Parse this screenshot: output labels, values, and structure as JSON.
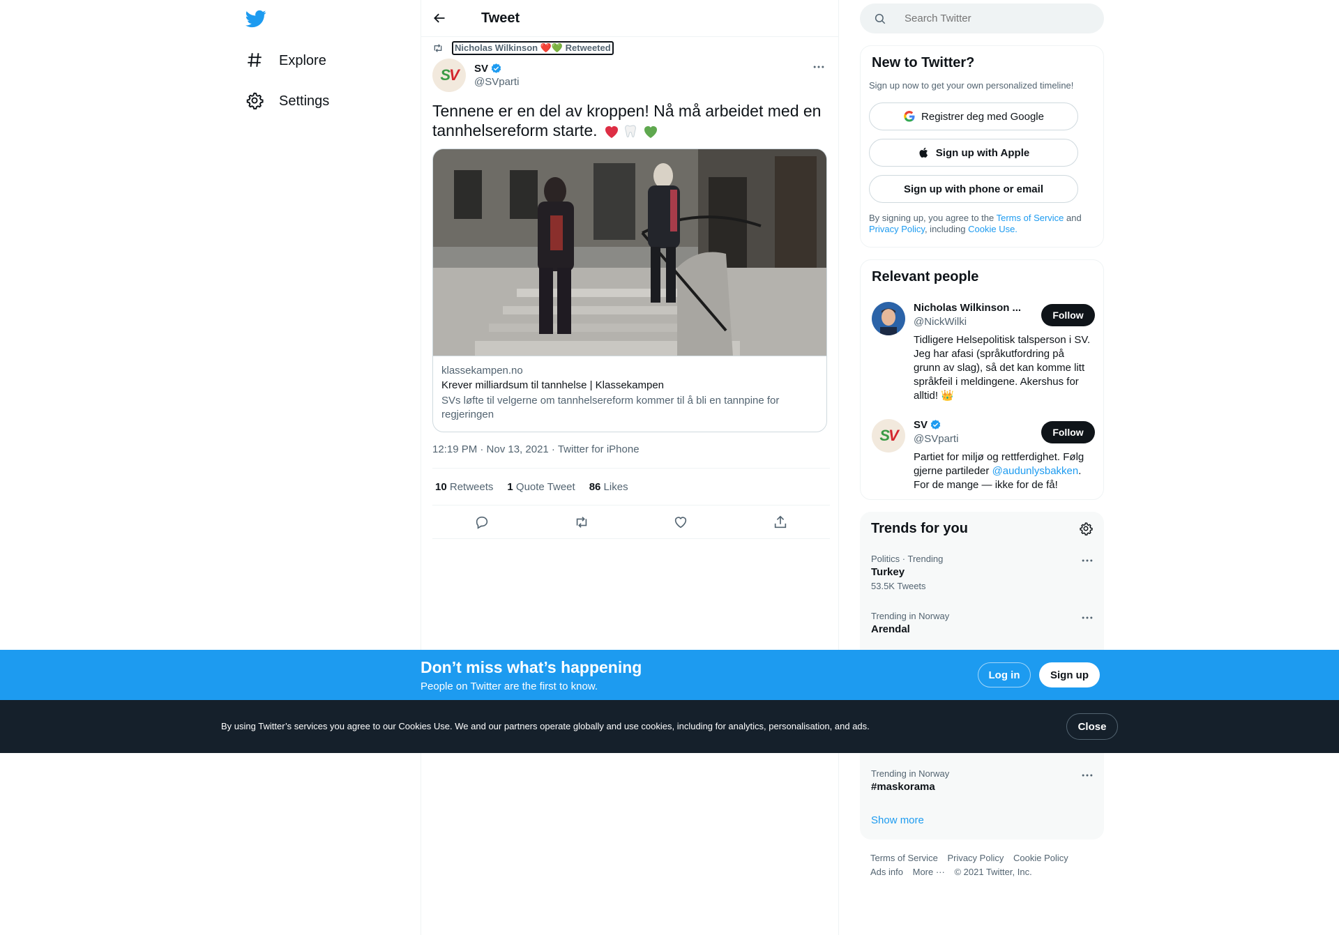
{
  "nav": {
    "logo": "twitter-bird-icon",
    "items": [
      {
        "label": "Explore",
        "icon": "hashtag-icon"
      },
      {
        "label": "Settings",
        "icon": "gear-icon"
      }
    ]
  },
  "header": {
    "title": "Tweet"
  },
  "tweet": {
    "retweeted_by": "Nicholas Wilkinson ❤️💚 Retweeted",
    "author_name": "SV",
    "author_handle": "@SVparti",
    "text": "Tennene er en del av kroppen! Nå må arbeidet med en tannhelsereform starte.",
    "card": {
      "domain": "klassekampen.no",
      "title": "Krever milliardsum til tannhelse | Klassekampen",
      "description": "SVs løfte til velgerne om tannhelsereform kommer til å bli en tannpine for regjeringen"
    },
    "meta": "12:19 PM · Nov 13, 2021 · Twitter for iPhone",
    "stats": {
      "retweets_count": "10",
      "retweets_label": "Retweets",
      "quotes_count": "1",
      "quotes_label": "Quote Tweet",
      "likes_count": "86",
      "likes_label": "Likes"
    }
  },
  "search": {
    "placeholder": "Search Twitter"
  },
  "new_to_twitter": {
    "title": "New to Twitter?",
    "subtitle": "Sign up now to get your own personalized timeline!",
    "google_label": "Registrer deg med Google",
    "apple_label": "Sign up with Apple",
    "phone_label": "Sign up with phone or email",
    "terms_1": "By signing up, you agree to the ",
    "terms_tos": "Terms of Service",
    "terms_2": " and ",
    "terms_privacy": "Privacy Policy",
    "terms_3": ", including ",
    "terms_cookie": "Cookie Use."
  },
  "relevant": {
    "title": "Relevant people",
    "people": [
      {
        "name": "Nicholas Wilkinson ...",
        "handle": "@NickWilki",
        "bio": "Tidligere Helsepolitisk talsperson i SV. Jeg har afasi (språkutfordring på grunn av slag), så det kan komme litt språkfeil i meldingene. Akershus for alltid! 👑",
        "follow": "Follow"
      },
      {
        "name": "SV",
        "handle": "@SVparti",
        "bio_1": "Partiet for miljø og rettferdighet. Følg gjerne partileder ",
        "bio_link": "@audunlysbakken",
        "bio_2": ". For de mange — ikke for de få!",
        "follow": "Follow"
      }
    ]
  },
  "trends": {
    "title": "Trends for you",
    "items": [
      {
        "meta": "Politics · Trending",
        "name": "Turkey",
        "count": "53.5K Tweets"
      },
      {
        "meta": "Trending in Norway",
        "name": "Arendal"
      },
      {
        "meta": "Trending in Norway",
        "name": "#maskorama"
      }
    ],
    "show_more": "Show more"
  },
  "footer": {
    "links": [
      "Terms of Service",
      "Privacy Policy",
      "Cookie Policy",
      "Ads info",
      "More ···",
      "© 2021 Twitter, Inc."
    ]
  },
  "banner": {
    "title": "Don’t miss what’s happening",
    "subtitle": "People on Twitter are the first to know.",
    "login": "Log in",
    "signup": "Sign up"
  },
  "cookie": {
    "text": "By using Twitter’s services you agree to our Cookies Use. We and our partners operate globally and use cookies, including for analytics, personalisation, and ads.",
    "close": "Close"
  },
  "colors": {
    "accent": "#1d9bf0",
    "text": "#0f1419",
    "muted": "#536471",
    "dark": "#15202b"
  }
}
